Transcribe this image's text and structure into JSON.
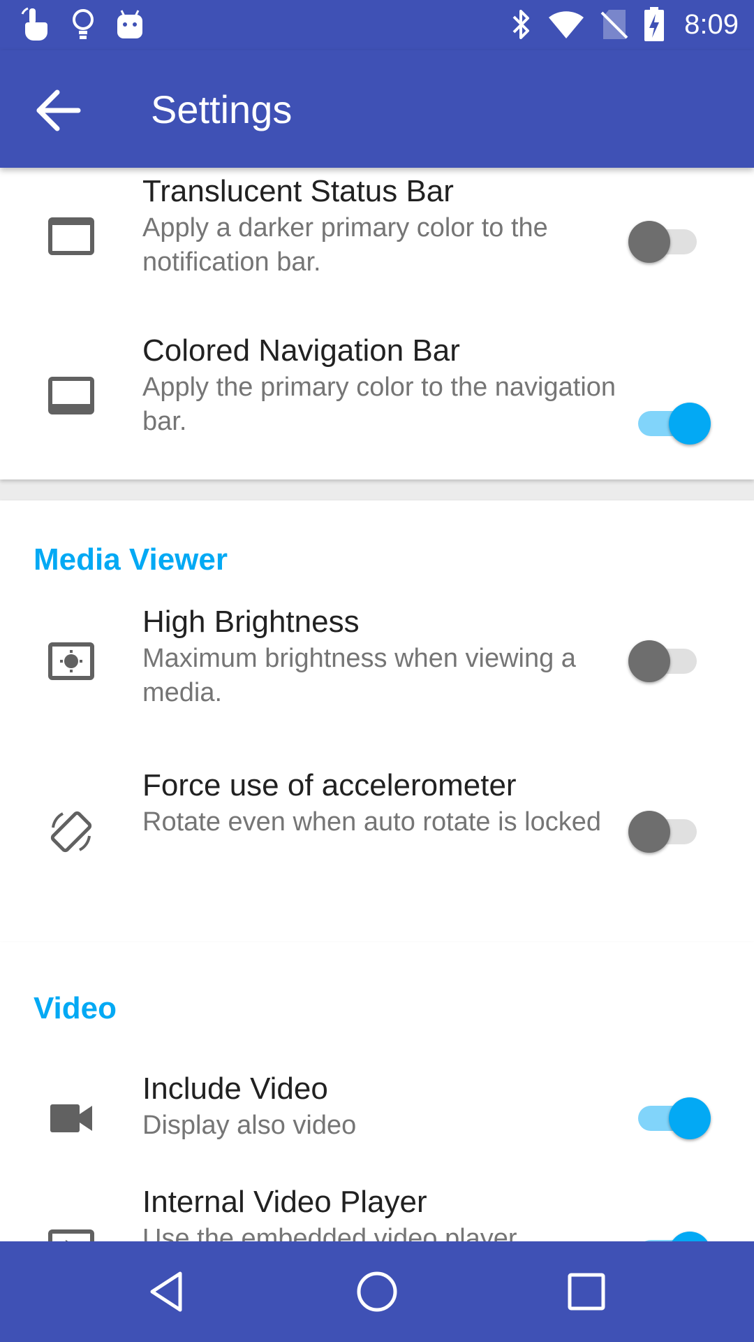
{
  "status_bar": {
    "time": "8:09",
    "left_icons": [
      "touch-icon",
      "bulb-icon",
      "android-icon"
    ],
    "right_icons": [
      "bluetooth-icon",
      "wifi-icon",
      "no-sim-icon",
      "battery-charging-icon"
    ]
  },
  "app_bar": {
    "title": "Settings",
    "back_icon": "arrow-back-icon"
  },
  "sections": [
    {
      "items": [
        {
          "icon": "status-bar-icon",
          "title": "Translucent Status Bar",
          "subtitle": "Apply a darker primary color to the notification bar.",
          "enabled": false
        },
        {
          "icon": "navigation-bar-icon",
          "title": "Colored Navigation Bar",
          "subtitle": "Apply the primary color to the navigation bar.",
          "enabled": true
        }
      ]
    },
    {
      "title": "Media Viewer",
      "items": [
        {
          "icon": "brightness-icon",
          "title": "High Brightness",
          "subtitle": "Maximum brightness when viewing a media.",
          "enabled": false
        },
        {
          "icon": "screen-rotation-icon",
          "title": "Force use of accelerometer",
          "subtitle": "Rotate even when auto rotate is locked",
          "enabled": false
        }
      ]
    },
    {
      "title": "Video",
      "items": [
        {
          "icon": "videocam-icon",
          "title": "Include Video",
          "subtitle": "Display also video",
          "enabled": true
        },
        {
          "icon": "video-player-icon",
          "title": "Internal Video Player",
          "subtitle": "Use the embedded video player",
          "enabled": true
        }
      ]
    }
  ],
  "nav_bar": {
    "icons": [
      "back-triangle-icon",
      "home-circle-icon",
      "recents-square-icon"
    ]
  },
  "colors": {
    "primary": "#3f51b5",
    "accent": "#03a9f4"
  }
}
